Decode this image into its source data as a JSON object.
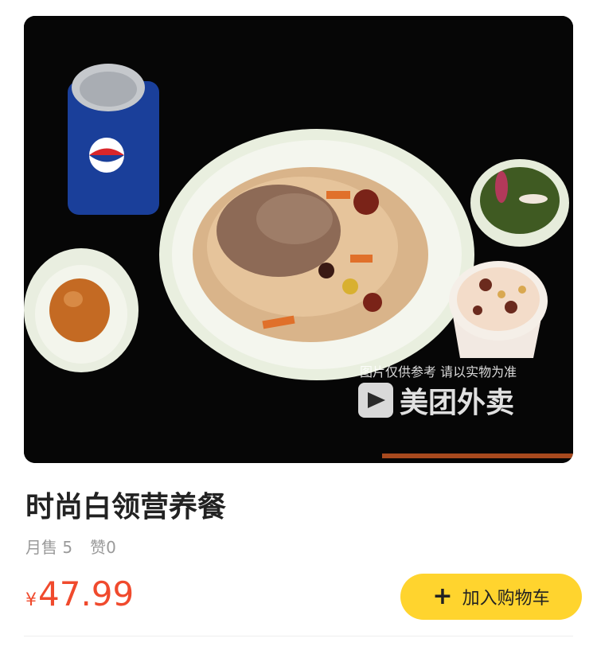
{
  "product": {
    "image_watermark_note": "图片仅供参考 请以实物为准",
    "image_watermark_brand": "美团外卖",
    "title": "时尚白领营养餐",
    "monthly_sales": "月售 5",
    "likes": "赞0",
    "currency": "¥",
    "price": "47.99",
    "add_to_cart_label": "加入购物车"
  },
  "colors": {
    "price": "#f04a2d",
    "cart_button": "#ffd42e"
  }
}
